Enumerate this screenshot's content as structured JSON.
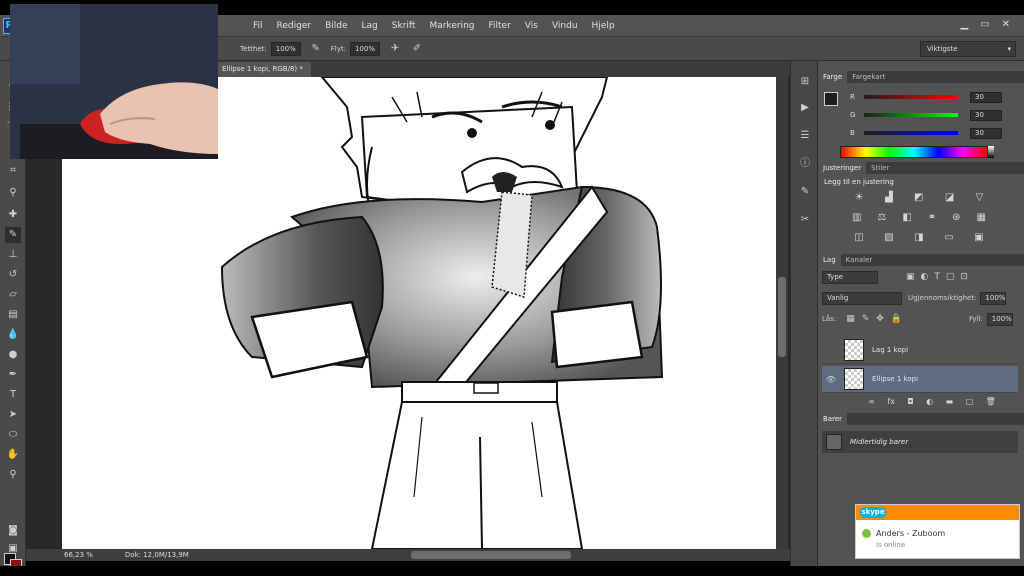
{
  "app": {
    "logo": "Ps"
  },
  "menu": [
    "Fil",
    "Rediger",
    "Bilde",
    "Lag",
    "Skrift",
    "Markering",
    "Filter",
    "Vis",
    "Vindu",
    "Hjelp"
  ],
  "options": {
    "opacity_label": "Tetthet:",
    "opacity_value": "100%",
    "flow_label": "Flyt:",
    "flow_value": "100%",
    "workspace": "Viktigste"
  },
  "document": {
    "tab_title": "Ellipse 1 kopi, RGB/8) *"
  },
  "status": {
    "zoom": "66,23 %",
    "doc_size": "Dok: 12,0M/13,9M"
  },
  "color_panel": {
    "tabs": [
      "Farge",
      "Fargekart"
    ],
    "channels": [
      {
        "label": "R",
        "value": "30"
      },
      {
        "label": "G",
        "value": "30"
      },
      {
        "label": "B",
        "value": "30"
      }
    ],
    "fg_color": "#1e1e1e",
    "bg_color": "#8b0f1a"
  },
  "adjustments_panel": {
    "tabs": [
      "Justeringer",
      "Stiler"
    ],
    "title": "Legg til en justering"
  },
  "layers_panel": {
    "tabs": [
      "Lag",
      "Kanaler"
    ],
    "filter_kind": "Type",
    "blend_mode": "Vanlig",
    "opacity_label": "Ugjennomsiktighet:",
    "opacity_value": "100%",
    "lock_label": "Lås:",
    "fill_label": "Fyll:",
    "fill_value": "100%",
    "layers": [
      {
        "name": "Lag 1 kopi",
        "selected": false
      },
      {
        "name": "Ellipse 1 kopi",
        "selected": true
      }
    ]
  },
  "history_panel": {
    "tabs": [
      "Barer"
    ],
    "item": "Midlertidig barer"
  },
  "skype": {
    "logo": "skype",
    "name": "Anders - Zuboom",
    "status": "is online"
  }
}
